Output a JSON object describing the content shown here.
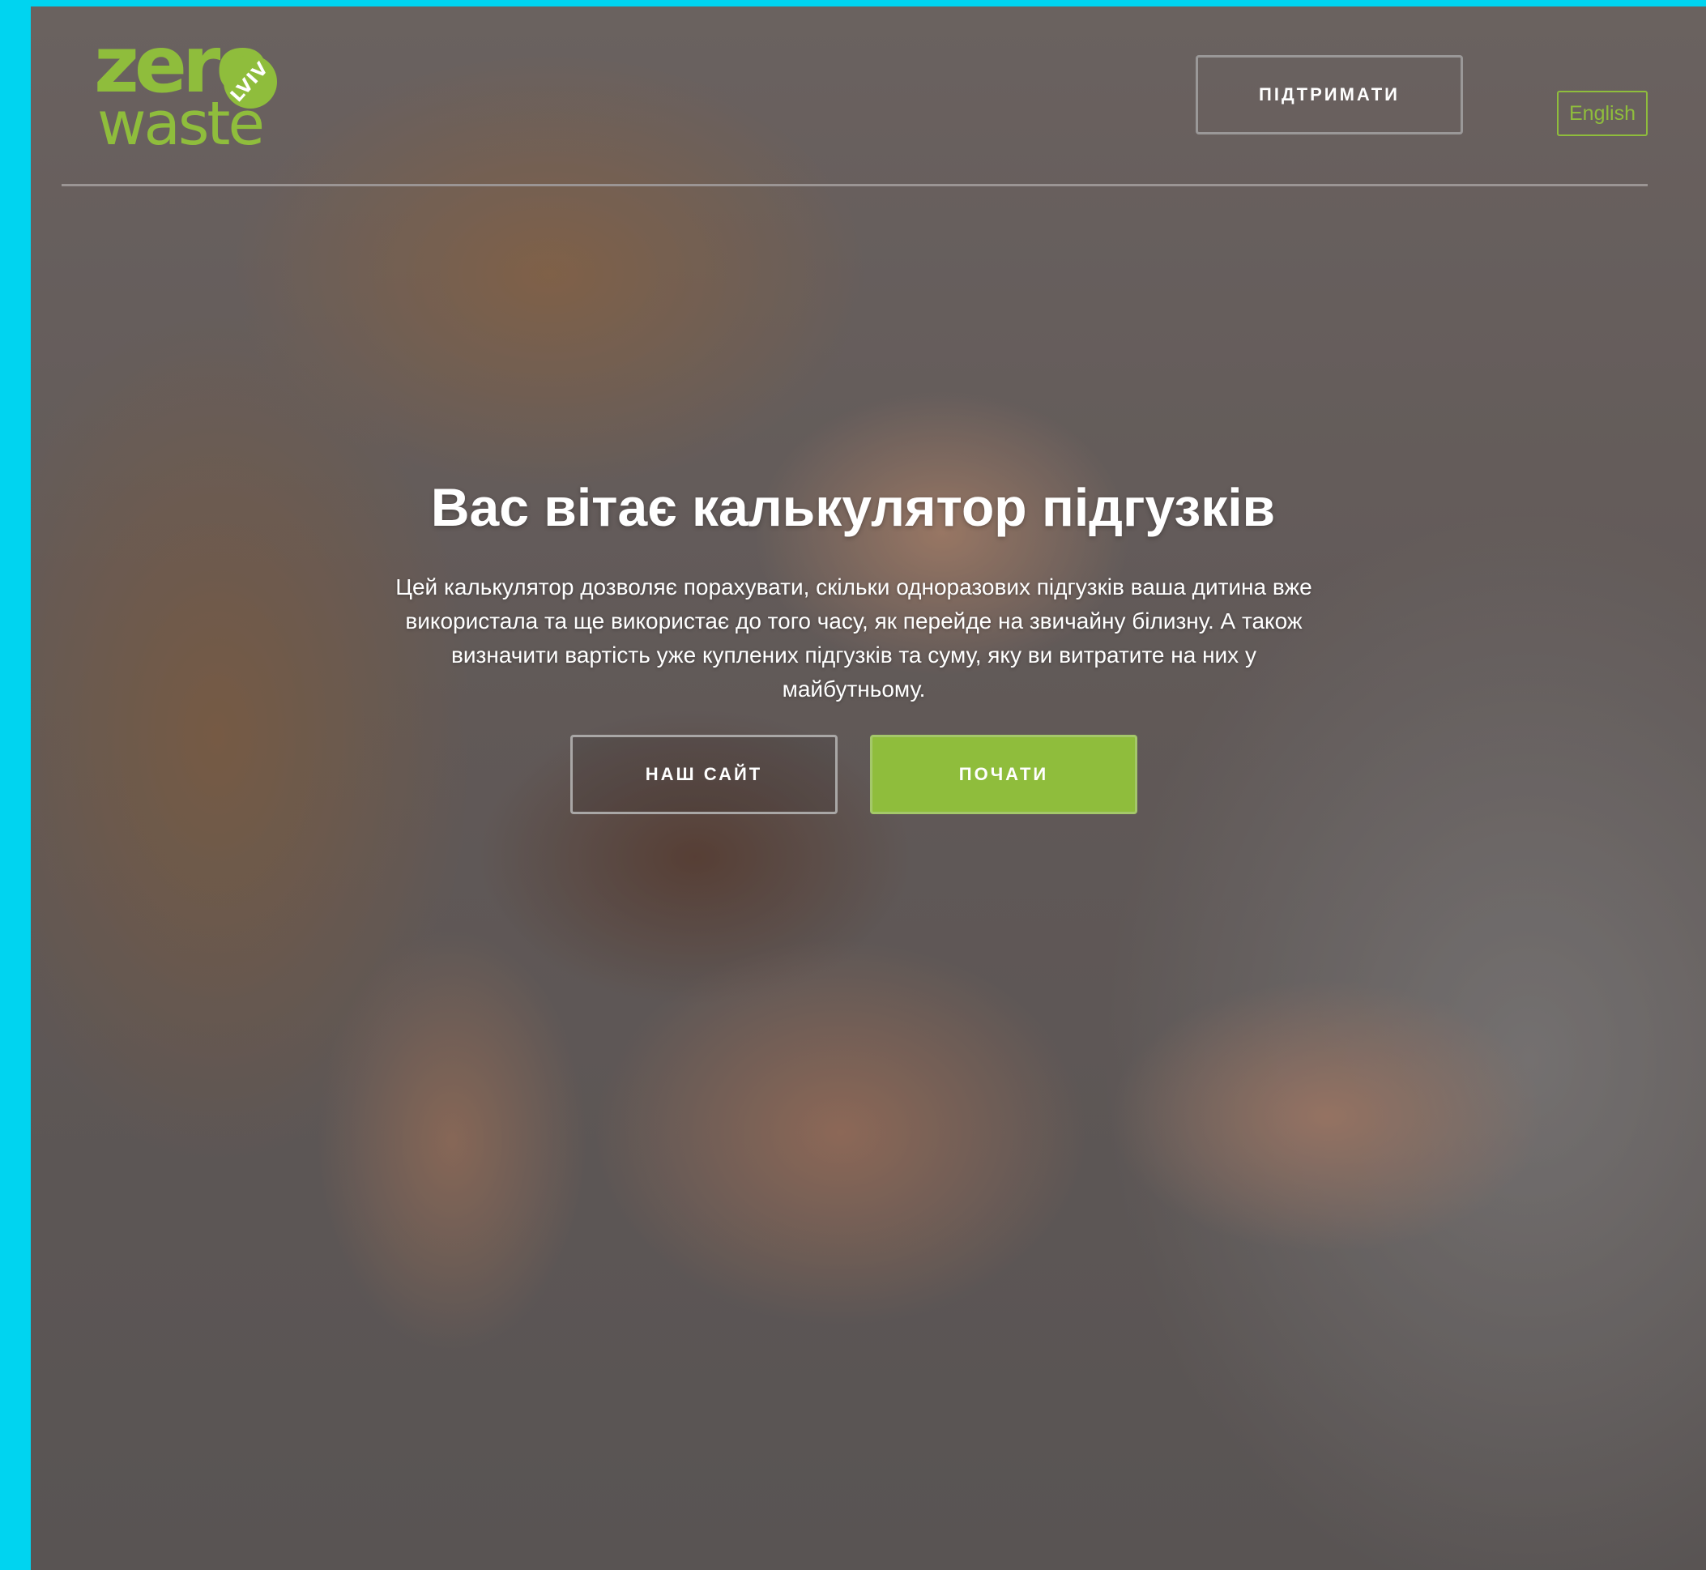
{
  "header": {
    "logo": {
      "word_top": "zero",
      "word_bottom": "waste",
      "badge": "LVIV"
    },
    "support_label": "ПІДТРИМАТИ",
    "language_label": "English"
  },
  "hero": {
    "title": "Вас вітає калькулятор підгузків",
    "description": "Цей калькулятор дозволяє порахувати, скільки одноразових підгузків ваша дитина вже використала та ще використає до того часу, як перейде на звичайну білизну. А також визначити вартість уже куплених підгузків та суму, яку ви витратите на них у майбутньому.",
    "site_button_label": "НАШ САЙТ",
    "start_button_label": "ПОЧАТИ"
  },
  "colors": {
    "brand_green": "#8fbd3c",
    "page_border": "#00d4f0"
  }
}
